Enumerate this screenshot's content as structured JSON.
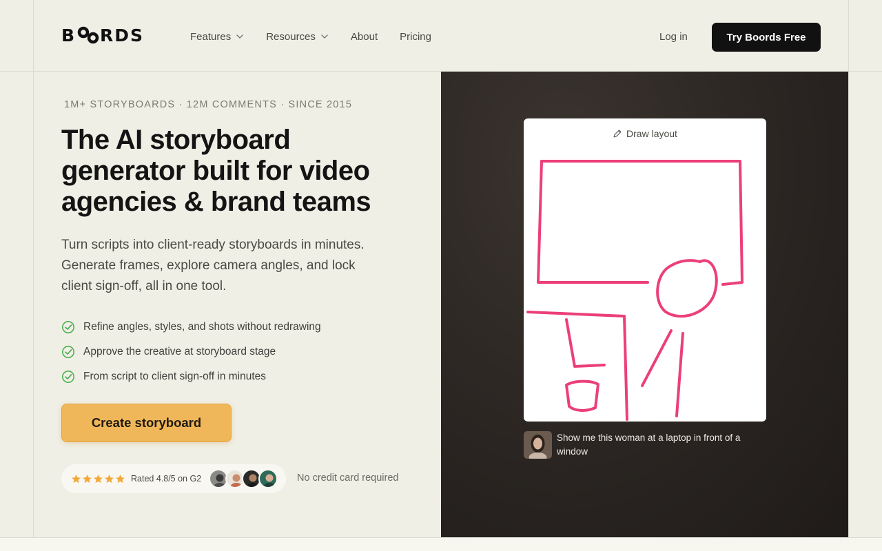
{
  "header": {
    "logo": "BOORDS",
    "nav": [
      {
        "label": "Features",
        "has_dropdown": true
      },
      {
        "label": "Resources",
        "has_dropdown": true
      },
      {
        "label": "About",
        "has_dropdown": false
      },
      {
        "label": "Pricing",
        "has_dropdown": false
      }
    ],
    "login_label": "Log in",
    "cta_label": "Try Boords Free"
  },
  "hero": {
    "eyebrow": "1M+ STORYBOARDS · 12M COMMENTS · SINCE 2015",
    "headline": "The AI storyboard generator built for video agencies & brand teams",
    "lede": "Turn scripts into client-ready storyboards in minutes. Generate frames, explore camera angles, and lock client sign-off, all in one tool.",
    "checks": [
      "Refine angles, styles, and shots without redrawing",
      "Approve the creative at storyboard stage",
      "From script to client sign-off in minutes"
    ],
    "cta_label": "Create storyboard",
    "rating": {
      "stars": 5,
      "text": "Rated 4.8/5 on G2"
    },
    "no_credit_card": "No credit card required"
  },
  "media": {
    "card_title": "Draw layout",
    "prompt": "Show me this woman at a laptop in front of a window"
  },
  "colors": {
    "accent": "#f0b75a",
    "check_green": "#4caf50",
    "sketch_pink": "#ec3f7a",
    "star_gold": "#f2a93b",
    "dark_button": "#111111"
  },
  "icons": {
    "nav_dropdown": "chevron-down-icon",
    "check": "check-circle-icon",
    "star": "star-icon",
    "pen": "pen-icon"
  }
}
